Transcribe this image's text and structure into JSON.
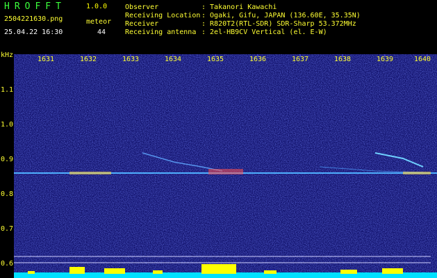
{
  "app": {
    "title": "HROFFT",
    "version": "1.0.0"
  },
  "file": {
    "name": "2504221630.png",
    "datetime": "25.04.22 16:30"
  },
  "meteor": {
    "label": "meteor",
    "count": "44"
  },
  "info": [
    {
      "key": "Observer",
      "value": ": Takanori Kawachi"
    },
    {
      "key": "Receiving Location",
      "value": ": Ogaki, Gifu, JAPAN (136.60E, 35.35N)"
    },
    {
      "key": "Receiver",
      "value": ": R820T2(RTL-SDR) SDR-Sharp 53.372MHz"
    },
    {
      "key": "Receiving antenna",
      "value": ": 2el-HB9CV Vertical (el. E-W)"
    }
  ],
  "axis": {
    "y_unit": "kHz",
    "y_labels": [
      "1.1",
      "1.0",
      "0.9",
      "0.8",
      "0.7",
      "0.6"
    ],
    "x_labels": [
      "1631",
      "1632",
      "1633",
      "1634",
      "1635",
      "1636",
      "1637",
      "1638",
      "1639",
      "1640"
    ]
  },
  "colors": {
    "background": "#000000",
    "spectrogram_bg": "#10106a",
    "carrier_line": "#4fb0ff",
    "activity_bar": "#ffff00",
    "activity_base": "#00e0ff",
    "label_yellow": "#ffff33",
    "title_green": "#3cff3c"
  }
}
